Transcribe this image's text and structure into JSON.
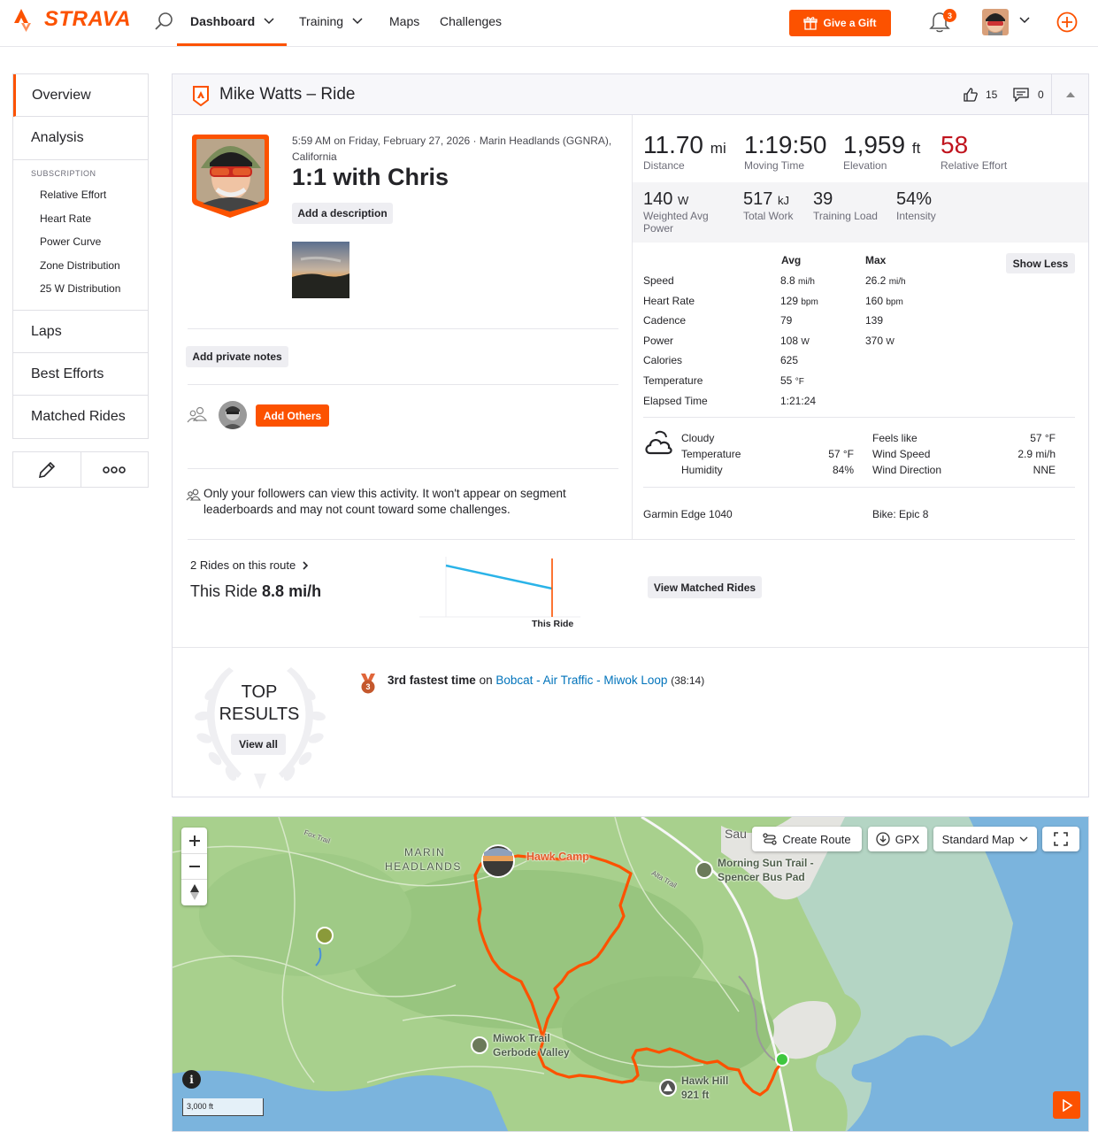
{
  "nav": {
    "brand": "STRAVA",
    "items": [
      {
        "label": "Dashboard"
      },
      {
        "label": "Training"
      },
      {
        "label": "Maps"
      },
      {
        "label": "Challenges"
      }
    ],
    "gift_label": "Give a Gift",
    "notifications_count": "3"
  },
  "sidebar": {
    "overview": "Overview",
    "analysis": "Analysis",
    "subscription_header": "SUBSCRIPTION",
    "sub_items": [
      "Relative Effort",
      "Heart Rate",
      "Power Curve",
      "Zone Distribution",
      "25 W Distribution"
    ],
    "laps": "Laps",
    "best_efforts": "Best Efforts",
    "matched_rides": "Matched Rides"
  },
  "activity": {
    "header_title": "Mike Watts – Ride",
    "kudos_count": "15",
    "comment_count": "0",
    "datetime_location": "5:59 AM on Friday, February 27, 2026 · Marin Headlands (GGNRA), California",
    "title": "1:1 with Chris",
    "add_description": "Add a description",
    "add_private_notes": "Add private notes",
    "add_others": "Add Others",
    "privacy_note": "Only your followers can view this activity. It won't appear on segment leaderboards and may not count toward some challenges."
  },
  "stats": {
    "primary": [
      {
        "value": "11.70",
        "unit": "mi",
        "label": "Distance"
      },
      {
        "value": "1:19:50",
        "unit": "",
        "label": "Moving Time"
      },
      {
        "value": "1,959",
        "unit": "ft",
        "label": "Elevation"
      },
      {
        "value": "58",
        "unit": "",
        "label": "Relative Effort",
        "color": "#c0141e"
      }
    ],
    "secondary": [
      {
        "value": "140",
        "unit": "W",
        "label": "Weighted Avg Power"
      },
      {
        "value": "517",
        "unit": "kJ",
        "label": "Total Work"
      },
      {
        "value": "39",
        "unit": "",
        "label": "Training Load"
      },
      {
        "value": "54%",
        "unit": "",
        "label": "Intensity"
      }
    ],
    "table_headers": {
      "avg": "Avg",
      "max": "Max"
    },
    "show_less": "Show Less",
    "rows": [
      {
        "label": "Speed",
        "avg": "8.8",
        "avg_unit": "mi/h",
        "max": "26.2",
        "max_unit": "mi/h"
      },
      {
        "label": "Heart Rate",
        "avg": "129",
        "avg_unit": "bpm",
        "max": "160",
        "max_unit": "bpm"
      },
      {
        "label": "Cadence",
        "avg": "79",
        "avg_unit": "",
        "max": "139",
        "max_unit": ""
      },
      {
        "label": "Power",
        "avg": "108",
        "avg_unit": "W",
        "max": "370",
        "max_unit": "W"
      },
      {
        "label": "Calories",
        "avg": "625",
        "avg_unit": "",
        "max": "",
        "max_unit": ""
      },
      {
        "label": "Temperature",
        "avg": "55",
        "avg_unit": "°F",
        "max": "",
        "max_unit": ""
      },
      {
        "label": "Elapsed Time",
        "avg": "1:21:24",
        "avg_unit": "",
        "max": "",
        "max_unit": ""
      }
    ],
    "weather": {
      "condition": "Cloudy",
      "temperature_label": "Temperature",
      "temperature": "57 °F",
      "humidity_label": "Humidity",
      "humidity": "84%",
      "feels_like_label": "Feels like",
      "feels_like": "57 °F",
      "wind_speed_label": "Wind Speed",
      "wind_speed": "2.9 mi/h",
      "wind_direction_label": "Wind Direction",
      "wind_direction": "NNE"
    },
    "device": "Garmin Edge 1040",
    "bike": "Bike: Epic 8"
  },
  "route": {
    "rides_on_route": "2 Rides on this route",
    "this_ride_prefix": "This Ride",
    "this_ride_value": "8.8 mi/h",
    "chart_marker_label": "This Ride",
    "view_matched": "View Matched Rides"
  },
  "top_results": {
    "title_line1": "TOP",
    "title_line2": "RESULTS",
    "view_all": "View all",
    "medal_rank": "3",
    "achievement_bold": "3rd fastest time",
    "achievement_on": "on",
    "segment_name": "Bobcat - Air Traffic - Miwok Loop",
    "segment_time": "(38:14)"
  },
  "map": {
    "create_route": "Create Route",
    "gpx": "GPX",
    "map_type": "Standard Map",
    "scale": "3,000 ft",
    "labels": {
      "hawk_camp": "Hawk Camp",
      "marin": "MARIN",
      "headlands": "HEADLANDS",
      "morning_sun_1": "Morning Sun Trail -",
      "morning_sun_2": "Spencer Bus Pad",
      "miwok_1": "Miwok Trail",
      "miwok_2": "Gerbode Valley",
      "hawk_hill_1": "Hawk Hill",
      "hawk_hill_2": "921 ft",
      "sau": "Sau",
      "fox_trail": "Fox Trail",
      "alta_trail": "Alta Trail"
    }
  }
}
